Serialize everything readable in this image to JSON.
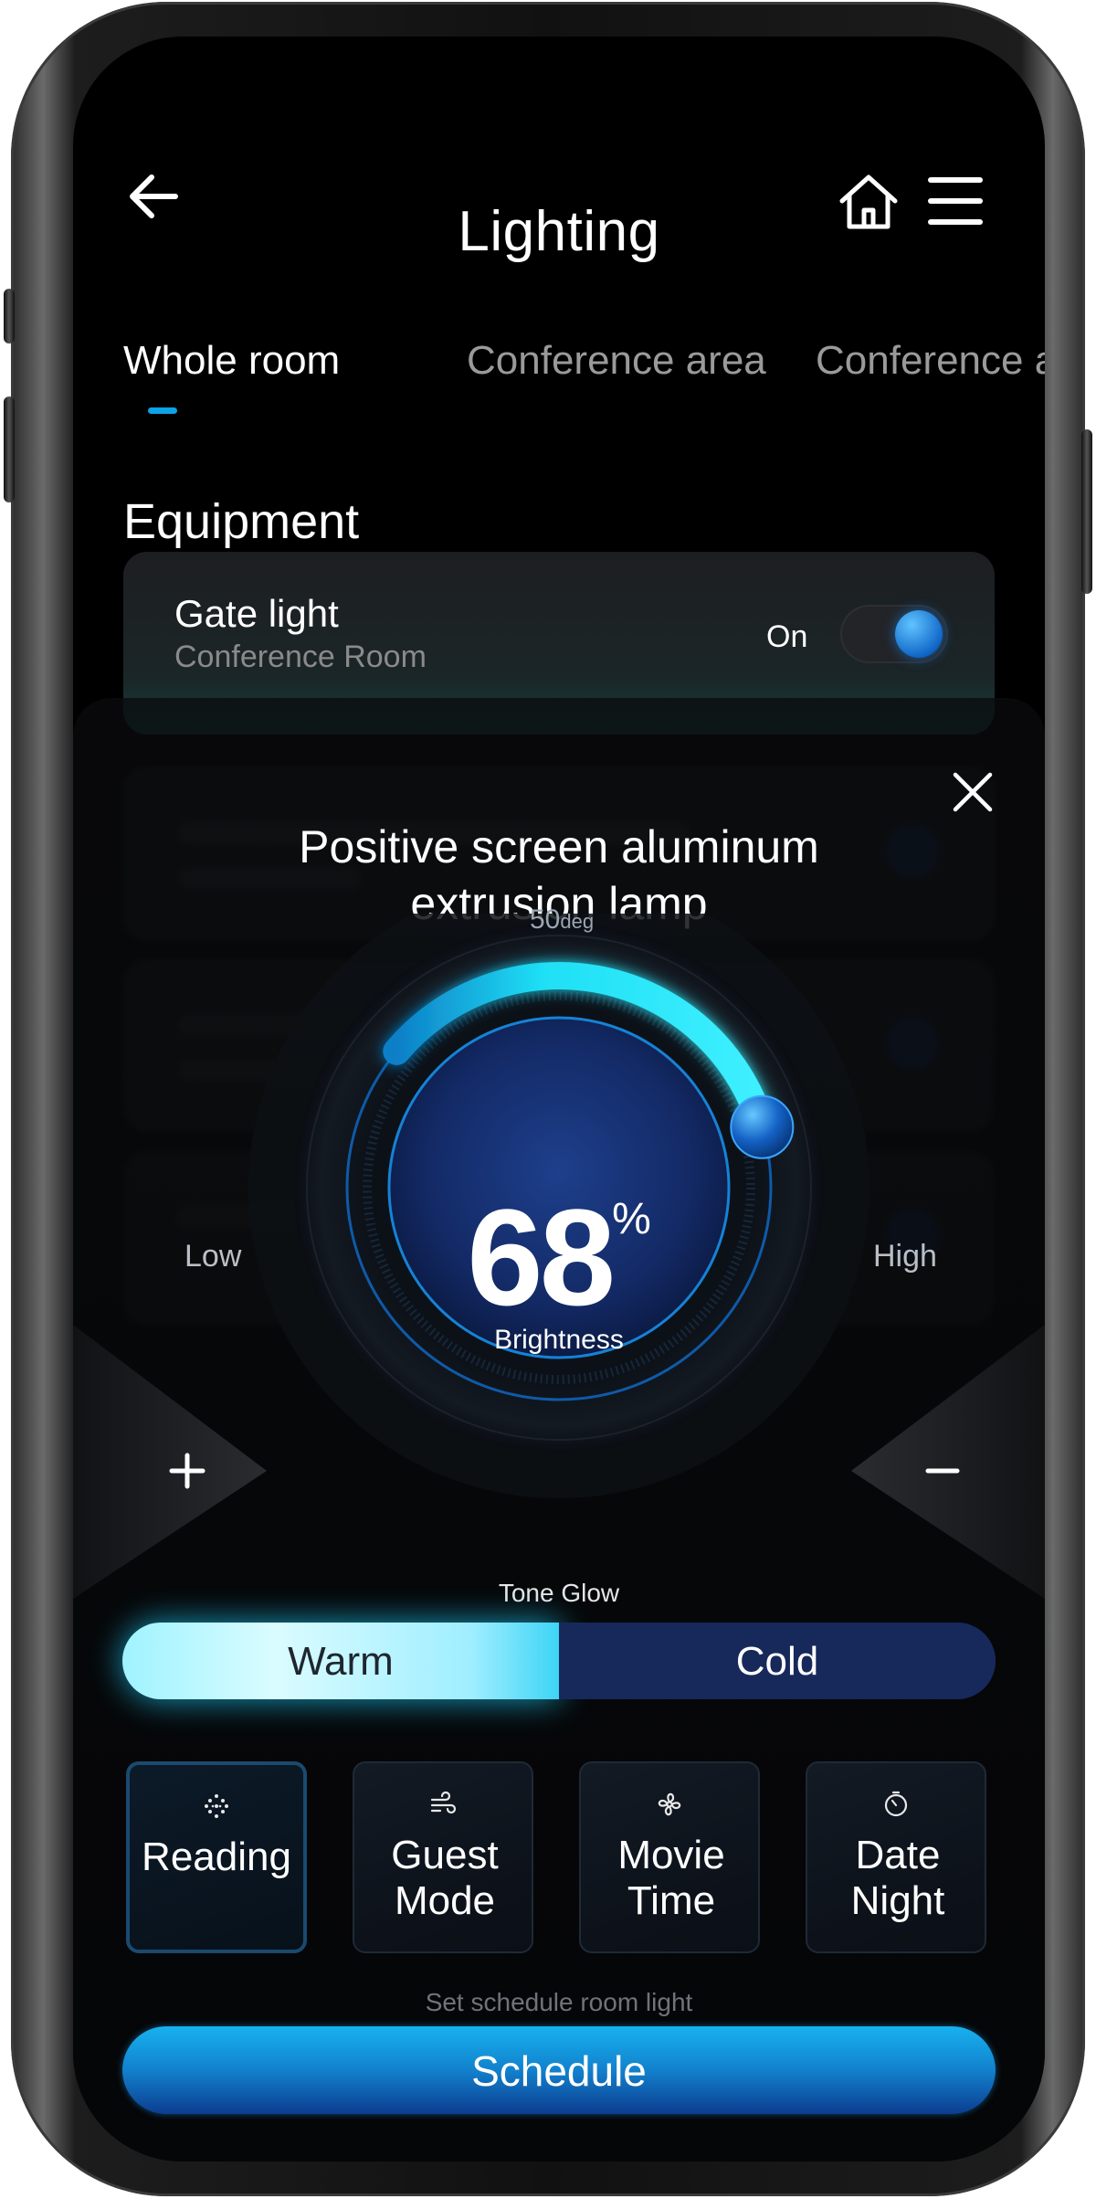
{
  "header": {
    "title": "Lighting"
  },
  "tabs": [
    {
      "label": "Whole room"
    },
    {
      "label": "Conference area"
    },
    {
      "label": "Conference area"
    }
  ],
  "equipment": {
    "section_title": "Equipment",
    "cards": [
      {
        "name": "Gate light",
        "location": "Conference Room",
        "state": "On"
      }
    ]
  },
  "modal": {
    "title": "Positive screen aluminum extrusion lamp",
    "dial": {
      "angle_value": "50",
      "angle_unit": "deg",
      "low_label": "Low",
      "high_label": "High",
      "brightness_value": "68",
      "brightness_unit": "%",
      "brightness_caption": "Brightness",
      "brightness_fraction": 0.68
    },
    "tone": {
      "label": "Tone Glow",
      "warm": "Warm",
      "cold": "Cold",
      "selected": "Warm"
    },
    "modes": [
      {
        "label": "Reading",
        "icon": "dots-grid-icon",
        "active": true
      },
      {
        "label": "Guest Mode",
        "icon": "wind-icon",
        "active": false
      },
      {
        "label": "Movie Time",
        "icon": "fan-icon",
        "active": false
      },
      {
        "label": "Date Night",
        "icon": "timer-icon",
        "active": false
      }
    ],
    "schedule_hint": "Set schedule room light",
    "schedule_button": "Schedule"
  },
  "colors": {
    "accent": "#0ba4e8",
    "dial_arc": "#22e4f6",
    "tone_warm": "#9ff3ff",
    "tone_cold": "#17295b",
    "schedule_button": "#1281cd"
  }
}
